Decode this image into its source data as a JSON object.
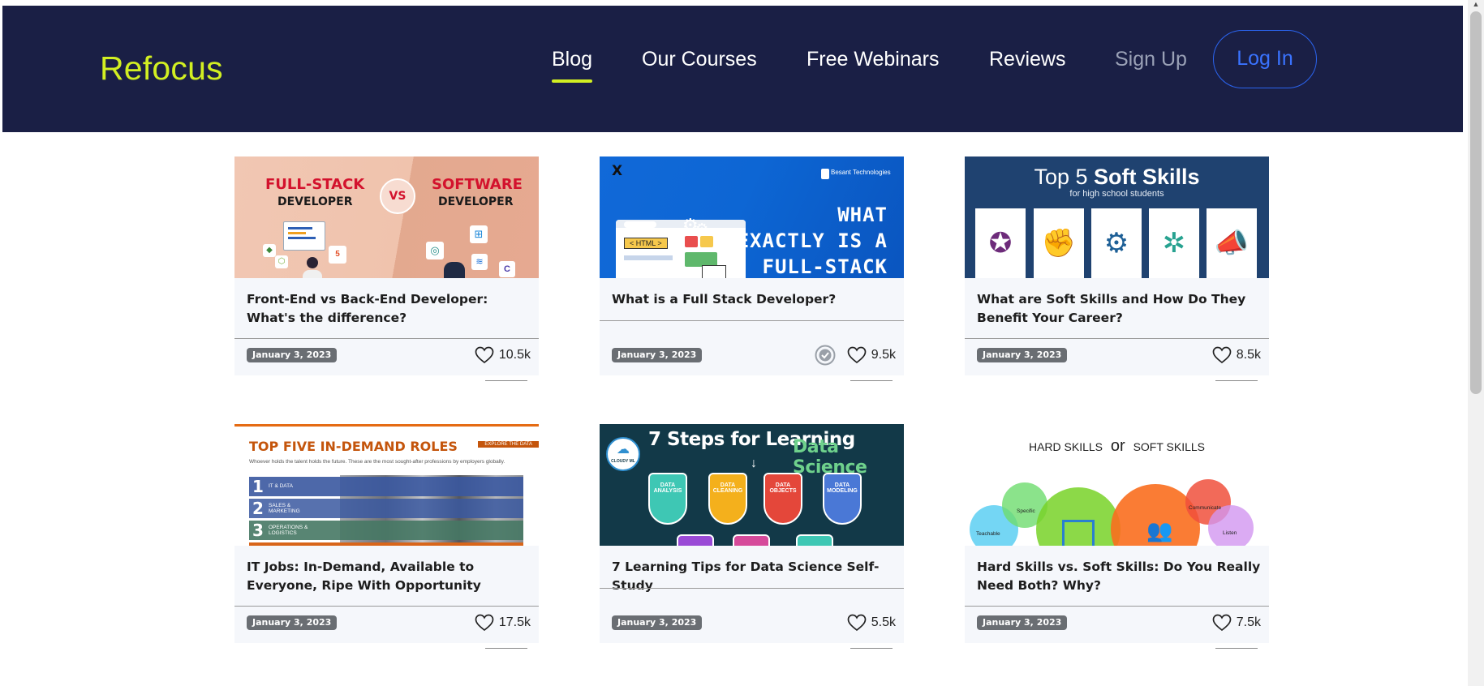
{
  "header": {
    "brand": "Refocus",
    "nav": [
      {
        "label": "Blog",
        "active": true
      },
      {
        "label": "Our Courses"
      },
      {
        "label": "Free Webinars"
      },
      {
        "label": "Reviews"
      },
      {
        "label": "Sign Up"
      }
    ],
    "login": "Log In"
  },
  "colors": {
    "navbar_bg": "#1a1f45",
    "brand": "#d2ef22",
    "login_accent": "#2b64ef",
    "card_bg": "#f5f7fb",
    "badge_bg": "#6a6e73"
  },
  "cards": [
    {
      "title": "Front-End vs Back-End Developer: What's the difference?",
      "date": "January 3, 2023",
      "likes": "10.5k",
      "thumb": {
        "left_top": "FULL-STACK",
        "left_bottom": "DEVELOPER",
        "vs": "VS",
        "right_top": "SOFTWARE",
        "right_bottom": "DEVELOPER"
      }
    },
    {
      "title": "What is a Full Stack Developer?",
      "date": "January 3, 2023",
      "likes": "9.5k",
      "verified": true,
      "thumb": {
        "close": "X",
        "brand": "Besant Technologies",
        "line1": "WHAT",
        "line2": "EXACTLY IS A",
        "line3": "FULL-STACK",
        "tag": "< HTML >"
      }
    },
    {
      "title": "What are Soft Skills and How Do They Benefit Your Career?",
      "date": "January 3, 2023",
      "likes": "8.5k",
      "thumb": {
        "heading_light": "Top 5",
        "heading_bold": "Soft Skills",
        "sub": "for high school students"
      }
    },
    {
      "title": "IT Jobs: In-Demand, Available to Everyone, Ripe With Opportunity",
      "date": "January 3, 2023",
      "likes": "17.5k",
      "thumb": {
        "heading": "TOP FIVE IN-DEMAND ROLES",
        "button": "EXPLORE THE DATA",
        "sub": "Whoever holds the talent holds the future. These are the most sought-after professions by employers globally.",
        "roles": [
          {
            "n": "1",
            "label": "IT & DATA"
          },
          {
            "n": "2",
            "label": "SALES & MARKETING"
          },
          {
            "n": "3",
            "label": "OPERATIONS & LOGISTICS"
          }
        ]
      }
    },
    {
      "title": "7 Learning Tips for Data Science Self-Study",
      "date": "January 3, 2023",
      "likes": "5.5k",
      "thumb": {
        "logo": "CLOUDY ML",
        "head1": "7 Steps for Learning",
        "head2": "Data Science",
        "badges": [
          {
            "label": "DATA ANALYSIS",
            "color": "#3ec7b4"
          },
          {
            "label": "DATA CLEANING",
            "color": "#f4b01c"
          },
          {
            "label": "DATA OBJECTS",
            "color": "#e4473a"
          },
          {
            "label": "DATA MODELING",
            "color": "#4a78d6"
          }
        ]
      }
    },
    {
      "title": "Hard Skills vs. Soft Skills: Do You Really Need Both? Why?",
      "date": "January 3, 2023",
      "likes": "7.5k",
      "thumb": {
        "hard": "HARD SKILLS",
        "or": "or",
        "soft": "SOFT SKILLS",
        "bubbles": [
          "Teachable",
          "Specific",
          "Communicate",
          "Listen"
        ]
      }
    }
  ]
}
